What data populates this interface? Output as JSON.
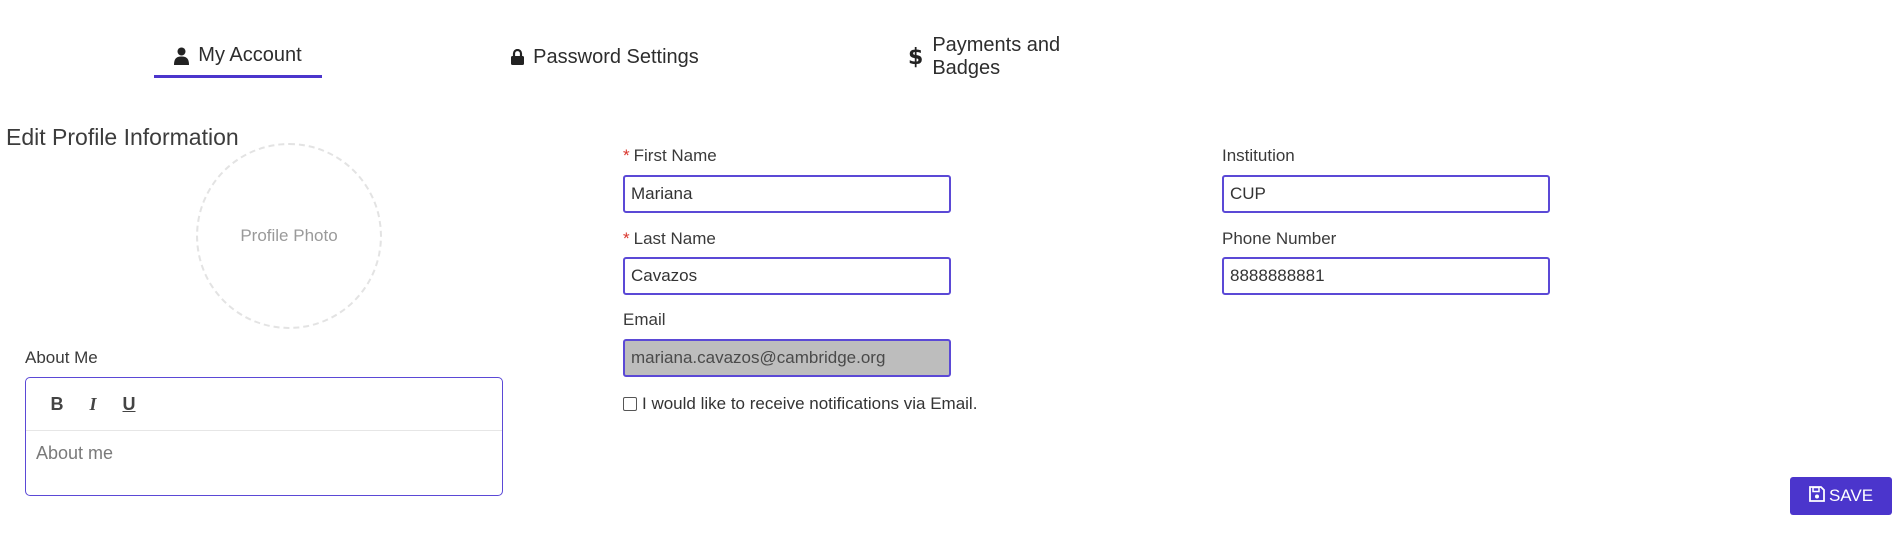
{
  "tabs": [
    {
      "label": "My Account",
      "icon": "user-icon",
      "active": true
    },
    {
      "label": "Password Settings",
      "icon": "lock-icon",
      "active": false
    },
    {
      "label": "Payments and Badges",
      "icon": "dollar-icon",
      "active": false
    }
  ],
  "section_title": "Edit Profile Information",
  "profile_photo": {
    "label": "Profile Photo"
  },
  "about_me": {
    "label": "About Me",
    "toolbar": {
      "bold": "B",
      "italic": "I",
      "underline": "U"
    },
    "placeholder": "About me"
  },
  "form": {
    "required_marker": "*",
    "first_name": {
      "label": "First Name",
      "value": "Mariana",
      "required": true
    },
    "last_name": {
      "label": "Last Name",
      "value": "Cavazos",
      "required": true
    },
    "email": {
      "label": "Email",
      "value": "mariana.cavazos@cambridge.org",
      "disabled": true
    },
    "institution": {
      "label": "Institution",
      "value": "CUP"
    },
    "phone": {
      "label": "Phone Number",
      "value": "8888888881"
    },
    "notifications": {
      "label": "I would like to receive notifications via Email.",
      "checked": false
    }
  },
  "save_button": {
    "label": "SAVE",
    "icon": "save-icon"
  },
  "colors": {
    "accent": "#4b35cc",
    "input_border": "#5b49d6",
    "required": "#d9342b",
    "disabled_bg": "#bdbdbd"
  }
}
